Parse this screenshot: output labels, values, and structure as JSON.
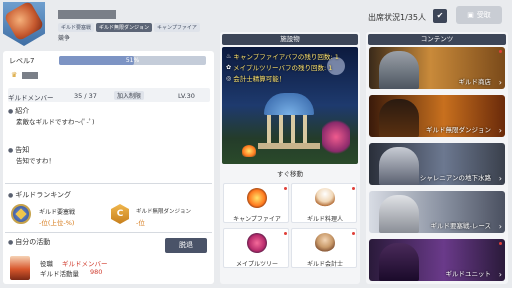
{
  "header": {
    "guild_tags": [
      "ギルド要塞戦",
      "ギルド無限ダンジョン",
      "キャンプファイア"
    ],
    "guild_type": "競争",
    "attendance_label": "出席状況",
    "attendance_value": "1/35人",
    "receive_label": "受取"
  },
  "guild_info": {
    "level_label": "レベル7",
    "level_progress_text": "51%",
    "level_progress": 0.51,
    "member_label": "ギルドメンバー",
    "member_count": "35 / 37",
    "join_limit_label": "加入制限",
    "join_limit_value": "LV.30",
    "intro_label": "紹介",
    "intro_text": "素敵なギルドですわ～(ﾟ-ﾟ)",
    "notice_label": "告知",
    "notice_text": "告知ですわ！"
  },
  "ranking": {
    "section_label": "ギルドランキング",
    "items": [
      {
        "title": "ギルド要塞戦",
        "value": "-位(上位-%)"
      },
      {
        "title": "ギルド無限ダンジョン",
        "value": "-位"
      }
    ]
  },
  "my_activity": {
    "section_label": "自分の活動",
    "leave_label": "脱退",
    "role_label": "役職",
    "role_value": "ギルドメンバー",
    "activity_label": "ギルド活動量",
    "activity_value": "980"
  },
  "facilities": {
    "title": "施設物",
    "buffs": [
      "キャンプファイアバフの残り回数: 1",
      "メイプルツリーバフの残り回数: 1",
      "会計士精算可能！"
    ],
    "quick_move_label": "すぐ移動",
    "tiles": [
      {
        "label": "キャンプファイア",
        "icon": "campfire-icon"
      },
      {
        "label": "ギルド料理人",
        "icon": "chef-icon"
      },
      {
        "label": "メイプルツリー",
        "icon": "maple-tree-icon"
      },
      {
        "label": "ギルド会計士",
        "icon": "accountant-icon"
      }
    ]
  },
  "contents": {
    "title": "コンテンツ",
    "banners": [
      {
        "label": "ギルド商店"
      },
      {
        "label": "ギルド無限ダンジョン"
      },
      {
        "label": "シャレニアンの地下水路"
      },
      {
        "label": "ギルド要塞戦-レース"
      },
      {
        "label": "ギルドユニット"
      }
    ]
  },
  "colors": {
    "panel_header": "#3d4658",
    "accent_orange": "#d67a1a",
    "accent_red": "#d0392b",
    "progress_fill": "#7d94c4"
  }
}
